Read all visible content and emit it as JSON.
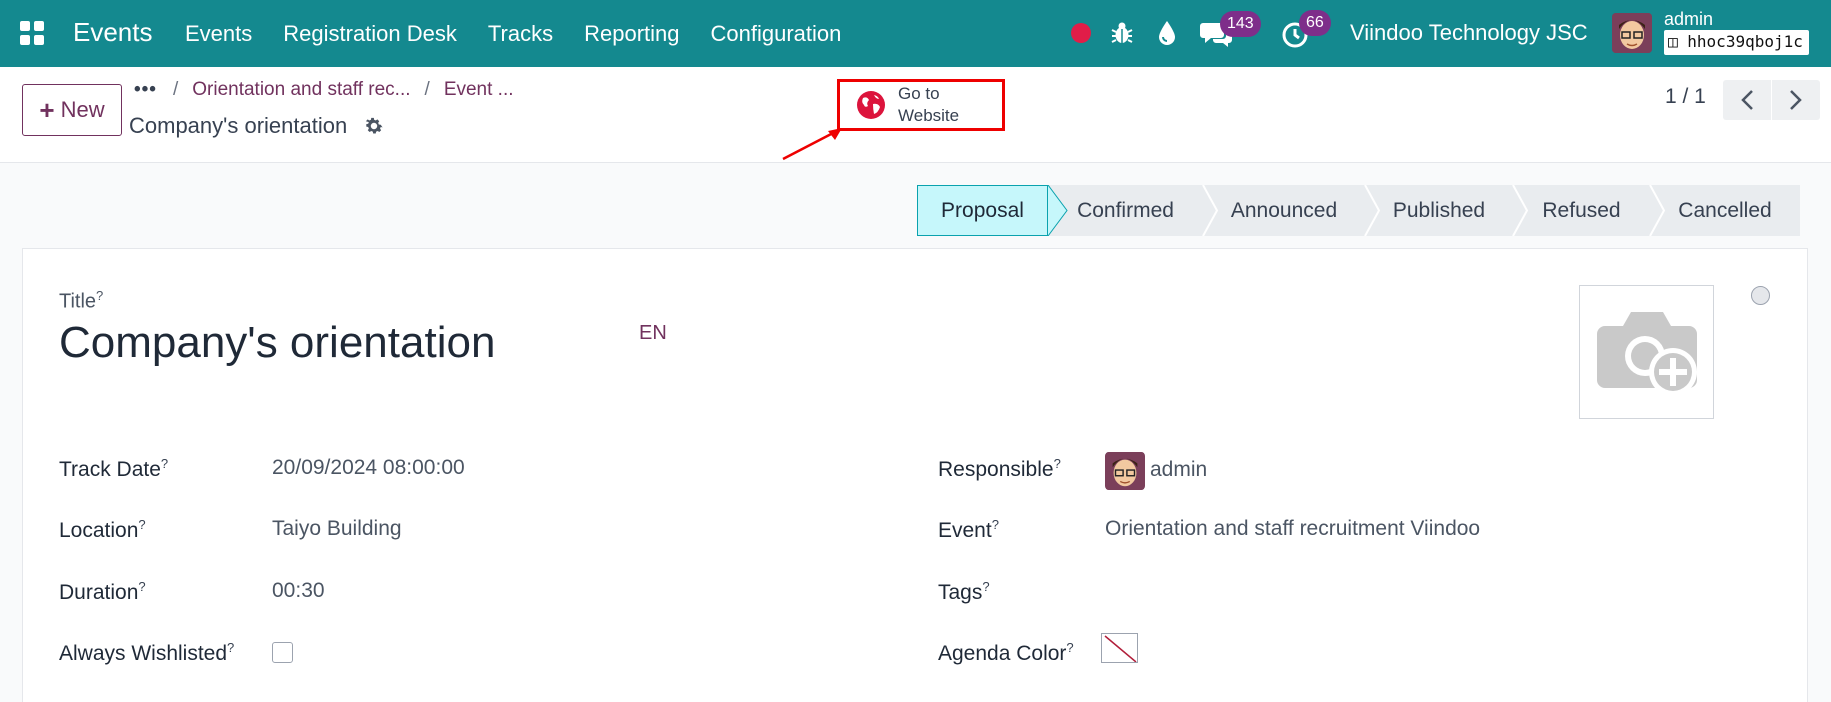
{
  "nav": {
    "app_name": "Events",
    "menu": [
      "Events",
      "Registration Desk",
      "Tracks",
      "Reporting",
      "Configuration"
    ],
    "messages_count": "143",
    "activities_count": "66",
    "company": "Viindoo Technology JSC",
    "user": "admin",
    "database": "hhoc39qboj1c"
  },
  "control": {
    "new_label": "New",
    "breadcrumb": [
      "Orientation and staff rec...",
      "Event ..."
    ],
    "record_title": "Company's orientation",
    "website_button": "Go to Website",
    "pager": "1 / 1"
  },
  "statusbar": {
    "stages": [
      "Proposal",
      "Confirmed",
      "Announced",
      "Published",
      "Refused",
      "Cancelled"
    ],
    "active": "Proposal"
  },
  "form": {
    "title_label": "Title",
    "title_value": "Company's orientation",
    "lang": "EN",
    "help_mark": "?",
    "left": [
      {
        "label": "Track Date",
        "value": "20/09/2024 08:00:00"
      },
      {
        "label": "Location",
        "value": "Taiyo Building"
      },
      {
        "label": "Duration",
        "value": "00:30"
      },
      {
        "label": "Always Wishlisted",
        "value": ""
      }
    ],
    "right": [
      {
        "label": "Responsible",
        "value": "admin"
      },
      {
        "label": "Event",
        "value": "Orientation and staff recruitment Viindoo"
      },
      {
        "label": "Tags",
        "value": ""
      },
      {
        "label": "Agenda Color",
        "value": ""
      }
    ]
  },
  "colors": {
    "navbar": "#14898f",
    "brand_purple": "#71325e",
    "active_stage": "#c6f7fb",
    "highlight": "#e00000"
  }
}
